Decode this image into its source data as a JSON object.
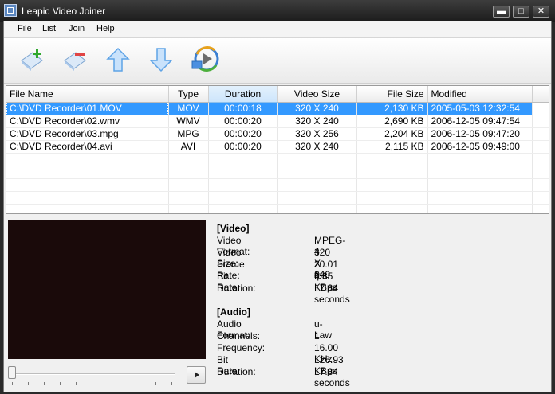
{
  "window": {
    "title": "Leapic Video Joiner",
    "controls": {
      "minimize": "▬",
      "maximize": "□",
      "close": "✕"
    }
  },
  "menu": [
    "File",
    "List",
    "Join",
    "Help"
  ],
  "toolbar": {
    "buttons": [
      "add-file-icon",
      "remove-file-icon",
      "move-up-icon",
      "move-down-icon",
      "join-video-icon"
    ]
  },
  "table": {
    "columns": [
      "File Name",
      "Type",
      "Duration",
      "Video Size",
      "File Size",
      "Modified"
    ],
    "rows": [
      [
        "C:\\DVD Recorder\\01.MOV",
        "MOV",
        "00:00:18",
        "320 X 240",
        "2,130 KB",
        "2005-05-03 12:32:54"
      ],
      [
        "C:\\DVD Recorder\\02.wmv",
        "WMV",
        "00:00:20",
        "320 X 240",
        "2,690 KB",
        "2006-12-05 09:47:54"
      ],
      [
        "C:\\DVD Recorder\\03.mpg",
        "MPG",
        "00:00:20",
        "320 X 256",
        "2,204 KB",
        "2006-12-05 09:47:20"
      ],
      [
        "C:\\DVD Recorder\\04.avi",
        "AVI",
        "00:00:20",
        "320 X 240",
        "2,115 KB",
        "2006-12-05 09:49:00"
      ]
    ],
    "selected_row": 0,
    "sorted_column": "Duration"
  },
  "info": {
    "video_header": "[Video]",
    "video": [
      {
        "label": "Video Format:",
        "value": "MPEG-4"
      },
      {
        "label": "Video Size:",
        "value": "320 X 240"
      },
      {
        "label": "Frame Rate:",
        "value": "20.01 fps"
      },
      {
        "label": "Bit Rate:",
        "value": "0.85 KBps"
      },
      {
        "label": "Duration:",
        "value": "17.84 seconds"
      }
    ],
    "audio_header": "[Audio]",
    "audio": [
      {
        "label": "Audio Format:",
        "value": "u-Law"
      },
      {
        "label": "Channels:",
        "value": "1"
      },
      {
        "label": "Frequency:",
        "value": "16.00 KHz"
      },
      {
        "label": "Bit Rate:",
        "value": "126.93 KBps"
      },
      {
        "label": "Duration:",
        "value": "17.84 seconds"
      }
    ]
  },
  "player": {
    "position": 0
  }
}
